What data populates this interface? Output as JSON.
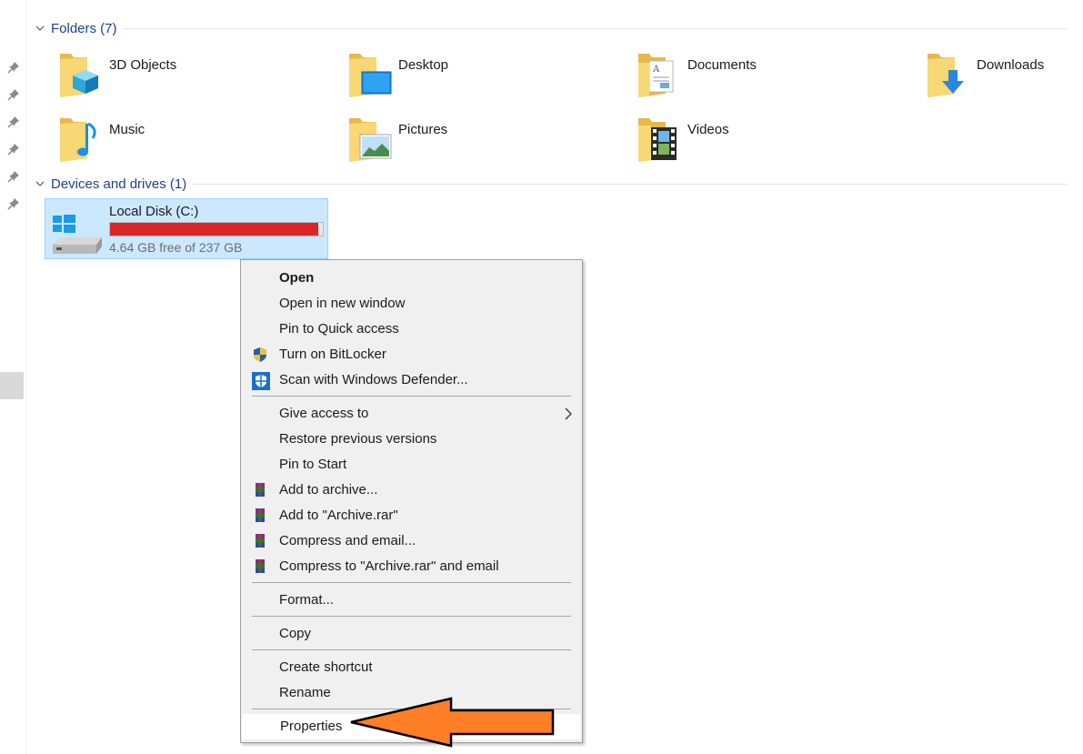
{
  "folders_section": {
    "title": "Folders (7)",
    "items": [
      {
        "label": "3D Objects",
        "icon": "3d-objects-folder-icon"
      },
      {
        "label": "Desktop",
        "icon": "desktop-folder-icon"
      },
      {
        "label": "Documents",
        "icon": "documents-folder-icon"
      },
      {
        "label": "Downloads",
        "icon": "downloads-folder-icon"
      },
      {
        "label": "Music",
        "icon": "music-folder-icon"
      },
      {
        "label": "Pictures",
        "icon": "pictures-folder-icon"
      },
      {
        "label": "Videos",
        "icon": "videos-folder-icon"
      }
    ]
  },
  "devices_section": {
    "title": "Devices and drives (1)",
    "drive": {
      "name": "Local Disk (C:)",
      "free_text": "4.64 GB free of 237 GB",
      "used_fraction": 0.98,
      "bar_color": "#da2626"
    }
  },
  "context_menu": {
    "items": [
      {
        "label": "Open",
        "bold": true
      },
      {
        "label": "Open in new window"
      },
      {
        "label": "Pin to Quick access"
      },
      {
        "label": "Turn on BitLocker",
        "icon": "uac-shield-icon"
      },
      {
        "label": "Scan with Windows Defender...",
        "icon": "defender-icon"
      },
      {
        "label": "Give access to",
        "submenu": true
      },
      {
        "label": "Restore previous versions"
      },
      {
        "label": "Pin to Start"
      },
      {
        "label": "Add to archive...",
        "icon": "winrar-icon"
      },
      {
        "label": "Add to \"Archive.rar\"",
        "icon": "winrar-icon"
      },
      {
        "label": "Compress and email...",
        "icon": "winrar-icon"
      },
      {
        "label": "Compress to \"Archive.rar\" and email",
        "icon": "winrar-icon"
      },
      {
        "label": "Format..."
      },
      {
        "label": "Copy"
      },
      {
        "label": "Create shortcut"
      },
      {
        "label": "Rename"
      },
      {
        "label": "Properties",
        "highlighted": true
      }
    ]
  },
  "colors": {
    "selection_bg": "#cce8ff",
    "group_title": "#1e3f8a",
    "annotation_arrow": "#ff7f27"
  }
}
